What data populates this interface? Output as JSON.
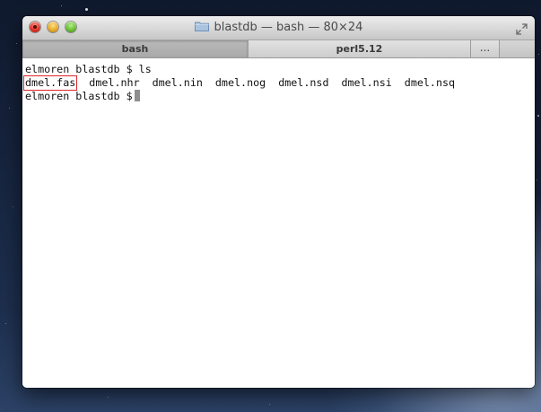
{
  "window": {
    "title": "blastdb — bash — 80×24"
  },
  "tabs": [
    {
      "label": "bash",
      "active": true
    },
    {
      "label": "perl5.12",
      "active": false
    }
  ],
  "tab_overflow": "...",
  "terminal": {
    "lines": [
      {
        "prompt": "elmoren blastdb $",
        "command": "ls"
      },
      {
        "prompt": "elmoren blastdb $",
        "command": ""
      }
    ],
    "files": [
      "dmel.fas",
      "dmel.nhr",
      "dmel.nin",
      "dmel.nog",
      "dmel.nsd",
      "dmel.nsi",
      "dmel.nsq"
    ],
    "highlighted_file": "dmel.fas",
    "highlight_color": "#e0242a"
  },
  "icons": {
    "close": "close-icon",
    "minimize": "minimize-icon",
    "zoom": "zoom-icon",
    "folder": "folder-icon",
    "fullscreen": "fullscreen-icon"
  }
}
